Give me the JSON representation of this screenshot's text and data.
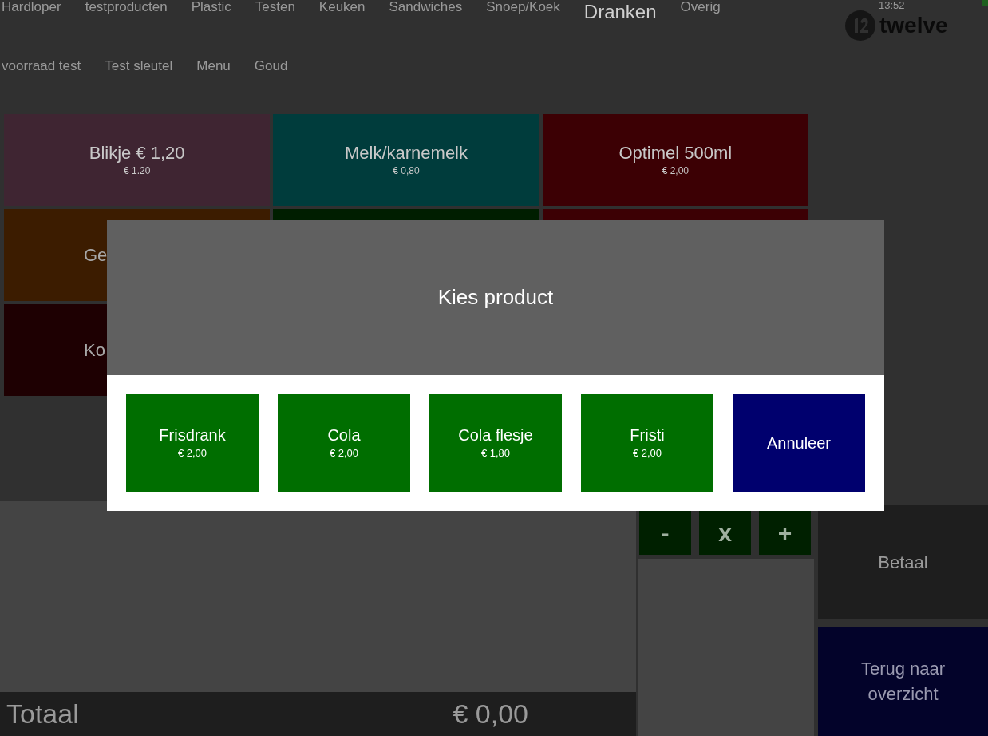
{
  "categories": [
    [
      {
        "label": "Hardloper",
        "selected": false
      },
      {
        "label": "testproducten",
        "selected": false
      },
      {
        "label": "Plastic",
        "selected": false
      },
      {
        "label": "Testen",
        "selected": false
      },
      {
        "label": "Keuken",
        "selected": false
      },
      {
        "label": "Sandwiches",
        "selected": false
      },
      {
        "label": "Snoep/Koek",
        "selected": false
      },
      {
        "label": "Dranken",
        "selected": true
      },
      {
        "label": "Overig",
        "selected": false
      }
    ],
    [
      {
        "label": "voorraad test",
        "selected": false
      },
      {
        "label": "Test sleutel",
        "selected": false
      },
      {
        "label": "Menu",
        "selected": false
      },
      {
        "label": "Goud",
        "selected": false
      }
    ]
  ],
  "clock": "13:52",
  "logo": {
    "text": "twelve"
  },
  "products": [
    [
      {
        "name": "Blikje € 1,20",
        "price": "€ 1.20",
        "color": "#3f2532",
        "covered": false
      },
      {
        "name": "Melk/karnemelk",
        "price": "€ 0,80",
        "color": "#003c3c",
        "covered": false
      },
      {
        "name": "Optimel 500ml",
        "price": "€ 2,00",
        "color": "#3c0004",
        "covered": false
      }
    ],
    [
      {
        "name": "Ge",
        "color": "#3c1c00",
        "covered": true
      },
      {
        "color": "#001e00"
      },
      {
        "color": "#3c0004"
      }
    ],
    [
      {
        "name": "Ko",
        "color": "#1e0002",
        "covered": true
      }
    ]
  ],
  "order_list": {
    "quantity_buttons": [
      "-",
      "x",
      "+"
    ]
  },
  "total": {
    "label": "Totaal",
    "amount": "€ 0,00"
  },
  "pay_button": "Betaal",
  "back_button": "Terug naar overzicht",
  "dialog": {
    "title": "Kies product",
    "options": [
      {
        "kind": "product",
        "name": "Frisdrank",
        "price": "€ 2,00"
      },
      {
        "kind": "product",
        "name": "Cola",
        "price": "€ 2,00"
      },
      {
        "kind": "product",
        "name": "Cola flesje",
        "price": "€ 1,80"
      },
      {
        "kind": "product",
        "name": "Fristi",
        "price": "€ 2,00"
      },
      {
        "kind": "cancel",
        "name": "Annuleer"
      }
    ]
  }
}
